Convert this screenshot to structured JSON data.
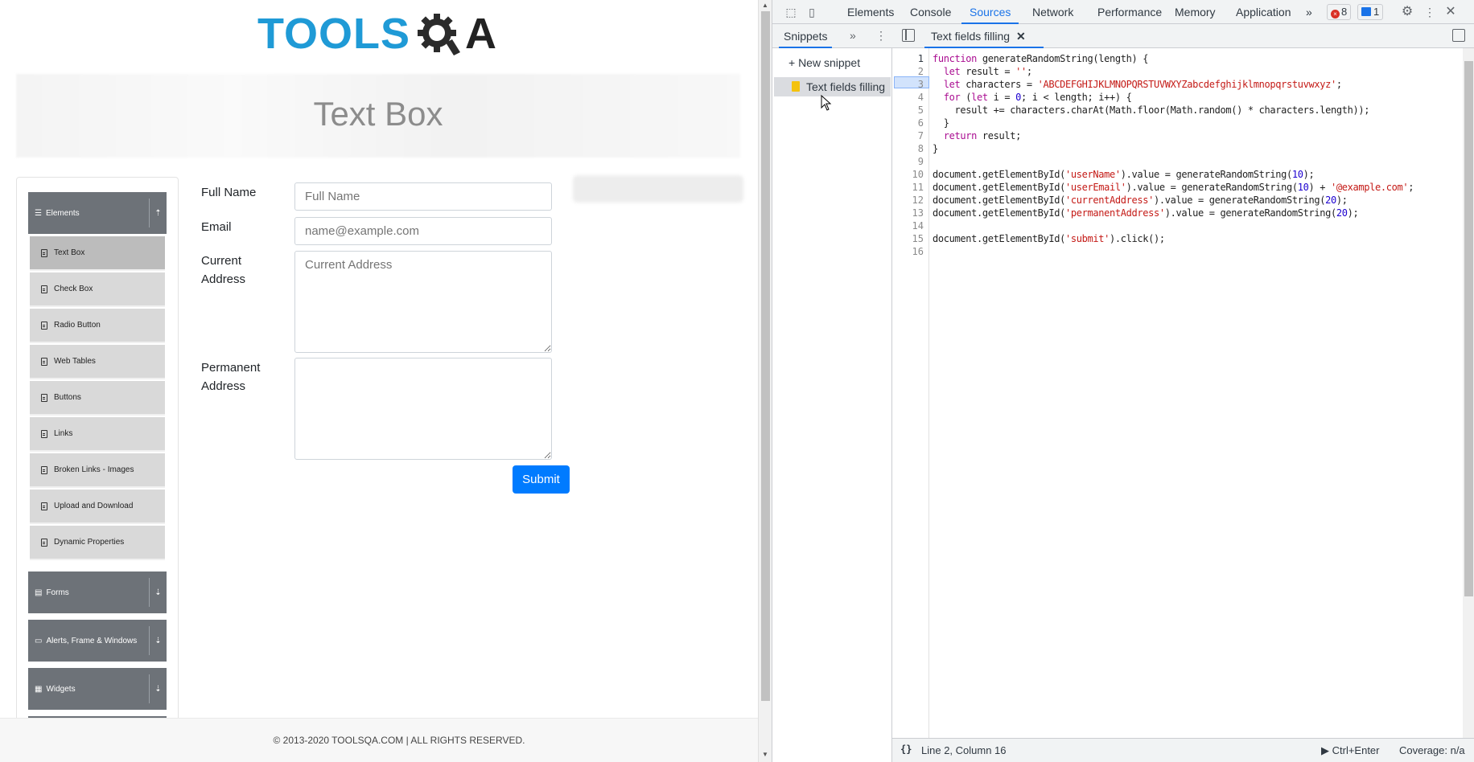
{
  "page": {
    "logo": {
      "text_main": "TOOLS",
      "text_suffix": "A",
      "brand_color": "#1f9ad6"
    },
    "banner_title": "Text Box",
    "sidebar": {
      "groups": [
        {
          "label": "Elements",
          "icon": "list-icon",
          "toggle": "⇡"
        },
        {
          "label": "Forms",
          "icon": "form-icon",
          "toggle": "⇣"
        },
        {
          "label": "Alerts, Frame & Windows",
          "icon": "window-icon",
          "toggle": "⇣"
        },
        {
          "label": "Widgets",
          "icon": "grid-icon",
          "toggle": "⇣"
        }
      ],
      "items": [
        {
          "label": "Text Box",
          "active": true
        },
        {
          "label": "Check Box"
        },
        {
          "label": "Radio Button"
        },
        {
          "label": "Web Tables"
        },
        {
          "label": "Buttons"
        },
        {
          "label": "Links"
        },
        {
          "label": "Broken Links - Images"
        },
        {
          "label": "Upload and Download"
        },
        {
          "label": "Dynamic Properties"
        }
      ]
    },
    "form": {
      "full_name_label": "Full Name",
      "full_name_placeholder": "Full Name",
      "email_label": "Email",
      "email_placeholder": "name@example.com",
      "current_address_label_1": "Current",
      "current_address_label_2": "Address",
      "current_address_placeholder": "Current Address",
      "permanent_address_label_1": "Permanent",
      "permanent_address_label_2": "Address",
      "submit_label": "Submit",
      "submit_color": "#007bff"
    },
    "footer": "© 2013-2020 TOOLSQA.COM | ALL RIGHTS RESERVED."
  },
  "devtools": {
    "tabs": [
      "Elements",
      "Console",
      "Sources",
      "Network",
      "Performance",
      "Memory",
      "Application"
    ],
    "active_tab": "Sources",
    "more_tabs": "»",
    "error_count": "8",
    "message_count": "1",
    "navigator": {
      "tab": "Snippets",
      "more": "»",
      "new_snippet": "+ New snippet",
      "snippet": "Text fields filling"
    },
    "editor": {
      "tab_label": "Text fields filling",
      "line_numbers": [
        "1",
        "2",
        "3",
        "4",
        "5",
        "6",
        "7",
        "8",
        "9",
        "10",
        "11",
        "12",
        "13",
        "14",
        "15",
        "16"
      ]
    },
    "status": {
      "format": "{}",
      "position": "Line 2, Column 16",
      "run": "▶ Ctrl+Enter",
      "coverage": "Coverage: n/a"
    }
  },
  "colors": {
    "accent": "#1a73e8",
    "error": "#d93025"
  }
}
